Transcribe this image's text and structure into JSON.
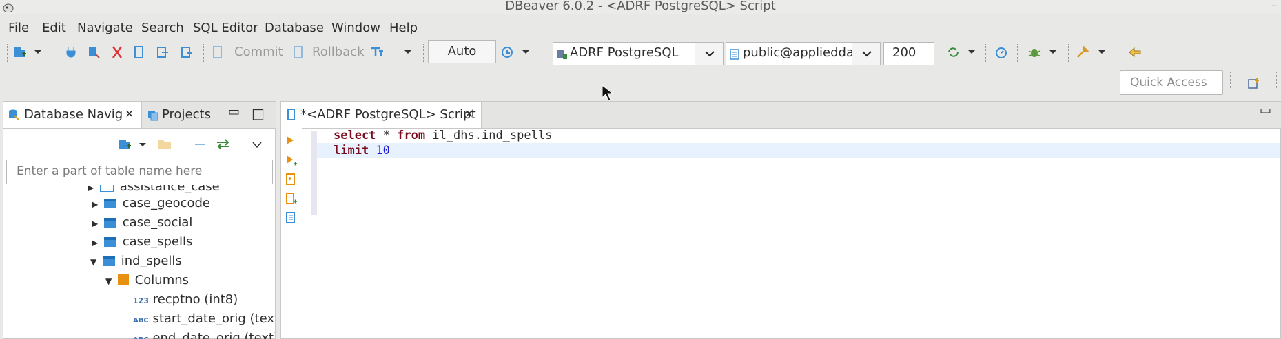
{
  "window": {
    "title": "DBeaver 6.0.2 - <ADRF PostgreSQL> Script"
  },
  "menu": [
    "File",
    "Edit",
    "Navigate",
    "Search",
    "SQL Editor",
    "Database",
    "Window",
    "Help"
  ],
  "toolbar": {
    "commit_label": "Commit",
    "rollback_label": "Rollback",
    "transaction_mode": "Auto",
    "connection": "ADRF PostgreSQL",
    "schema": "public@appliedda",
    "result_limit": "200",
    "quick_access_placeholder": "Quick Access"
  },
  "navigator": {
    "tab_database": "Database Navig",
    "tab_projects": "Projects",
    "filter_placeholder": "Enter a part of table name here",
    "tree": [
      {
        "label": "assistance_case",
        "type": "table",
        "expanded": false,
        "depth": 1
      },
      {
        "label": "case_geocode",
        "type": "table",
        "expanded": false,
        "depth": 1
      },
      {
        "label": "case_social",
        "type": "table",
        "expanded": false,
        "depth": 1
      },
      {
        "label": "case_spells",
        "type": "table",
        "expanded": false,
        "depth": 1
      },
      {
        "label": "ind_spells",
        "type": "table",
        "expanded": true,
        "depth": 1
      },
      {
        "label": "Columns",
        "type": "folder",
        "expanded": true,
        "depth": 2
      },
      {
        "label": "recptno (int8)",
        "type": "numeric",
        "depth": 3
      },
      {
        "label": "start_date_orig (text)",
        "type": "text",
        "depth": 3
      },
      {
        "label": "end_date_orig (text)",
        "type": "text",
        "depth": 3
      }
    ]
  },
  "editor": {
    "tab_label": "*<ADRF PostgreSQL> Script",
    "lines": [
      {
        "kw1": "select",
        "rest1": " * ",
        "kw2": "from",
        "rest2": " il_dhs.ind_spells"
      },
      {
        "kw1": "limit",
        "num": "10"
      }
    ]
  }
}
